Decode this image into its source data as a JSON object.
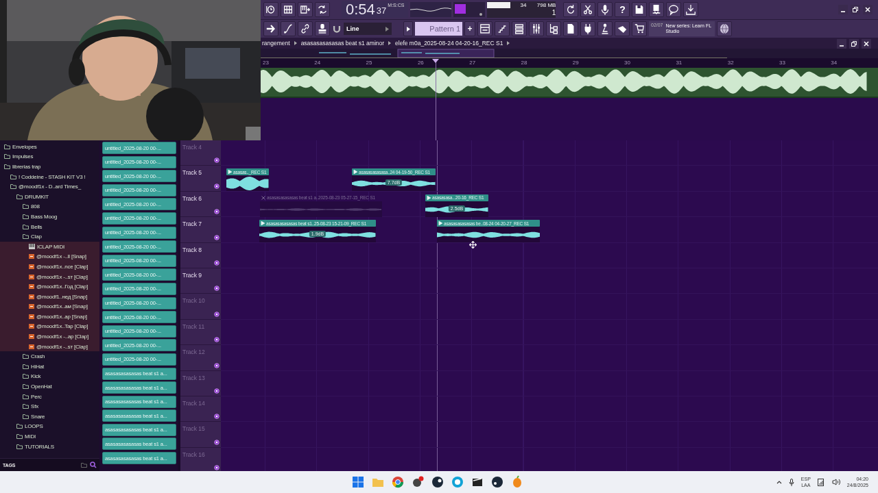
{
  "toolbar": {
    "time": "0:54",
    "time_small": "37",
    "time_format": "M:S:CS",
    "cpu": "34",
    "memory": "798 MB",
    "polyphony": "1",
    "help": "?",
    "snap": "Line",
    "pattern": "Pattern 1",
    "pattern_add": "+",
    "news_count": "02/07",
    "news_text": "New series: Learn FL Studio"
  },
  "breadcrumb": [
    "rangement",
    "asasasasasasas beat s1 aminor",
    "elefe m0a_2025-08-24 04-20-16_REC S1"
  ],
  "ruler": [
    "23",
    "24",
    "25",
    "26",
    "27",
    "28",
    "29",
    "30",
    "31",
    "32",
    "33",
    "34"
  ],
  "browser": {
    "items": [
      {
        "label": "Envelopes",
        "kind": "folder"
      },
      {
        "label": "Impulses",
        "kind": "folder"
      },
      {
        "label": "librerias trap",
        "kind": "folder",
        "children": [
          {
            "label": "! Coddeine - STASH KIT V3 !",
            "kind": "folder"
          },
          {
            "label": "@moodf1x - D..ard Times_",
            "kind": "folder",
            "children": [
              {
                "label": "DRUMKIT",
                "kind": "folder",
                "children": [
                  {
                    "label": "808",
                    "kind": "folder"
                  },
                  {
                    "label": "Bass Moog",
                    "kind": "folder"
                  },
                  {
                    "label": "Bells",
                    "kind": "folder"
                  },
                  {
                    "label": "Clap",
                    "kind": "folder",
                    "children": [
                      {
                        "label": "ICLAP MIDI",
                        "kind": "midi"
                      },
                      {
                        "label": "@moodf1x -..ll [Snap]",
                        "kind": "audio"
                      },
                      {
                        "label": "@moodf1x..nce [Clap]",
                        "kind": "audio"
                      },
                      {
                        "label": "@moodf1x -..sт [Clap]",
                        "kind": "audio"
                      },
                      {
                        "label": "@moodf1x..Год [Clap]",
                        "kind": "audio"
                      },
                      {
                        "label": "@moodf1..нед [Snap]",
                        "kind": "audio"
                      },
                      {
                        "label": "@moodf1x..ам [Snap]",
                        "kind": "audio"
                      },
                      {
                        "label": "@moodf1x..ap [Snap]",
                        "kind": "audio"
                      },
                      {
                        "label": "@moodf1x..Tap [Clap]",
                        "kind": "audio"
                      },
                      {
                        "label": "@moodf1x -..ap [Clap]",
                        "kind": "audio"
                      },
                      {
                        "label": "@moodf1x -..sт [Clap]",
                        "kind": "audio"
                      }
                    ]
                  },
                  {
                    "label": "Crash",
                    "kind": "folder"
                  },
                  {
                    "label": "HiHat",
                    "kind": "folder"
                  },
                  {
                    "label": "Kick",
                    "kind": "folder"
                  },
                  {
                    "label": "OpenHat",
                    "kind": "folder"
                  },
                  {
                    "label": "Perc",
                    "kind": "folder"
                  },
                  {
                    "label": "Sfx",
                    "kind": "folder"
                  },
                  {
                    "label": "Snare",
                    "kind": "folder"
                  }
                ]
              },
              {
                "label": "LOOPS",
                "kind": "folder"
              },
              {
                "label": "MIDI",
                "kind": "folder"
              },
              {
                "label": "TUTORIALS",
                "kind": "folder"
              }
            ]
          }
        ]
      }
    ],
    "footer": "TAGS"
  },
  "clip_list": [
    "untitled_2025-08-20 00-...",
    "untitled_2025-08-20 00-...",
    "untitled_2025-08-20 00-...",
    "untitled_2025-08-20 00-...",
    "untitled_2025-08-20 00-...",
    "untitled_2025-08-20 00-...",
    "untitled_2025-08-20 00-...",
    "untitled_2025-08-20 00-...",
    "untitled_2025-08-20 00-...",
    "untitled_2025-08-20 00-...",
    "untitled_2025-08-20 00-...",
    "untitled_2025-08-20 00-...",
    "untitled_2025-08-20 00-...",
    "untitled_2025-08-20 00-...",
    "untitled_2025-08-20 00-...",
    "untitled_2025-08-20 00-...",
    "asasasasasasas beat s1 a...",
    "asasasasasasas beat s1 a...",
    "asasasasasasas beat s1 a...",
    "asasasasasasas beat s1 a...",
    "asasasasasasas beat s1 a...",
    "asasasasasasas beat s1 a...",
    "asasasasasasas beat s1 a..."
  ],
  "tracks": [
    {
      "name": "Track 4",
      "dimmed": true
    },
    {
      "name": "Track 5",
      "dimmed": false,
      "clips": [
        {
          "label": "asasas.._REC S1",
          "muted": false
        },
        {
          "label": "asasasasasasa..24 04-19-50_REC S1",
          "gain": "7.7dB",
          "muted": false
        }
      ]
    },
    {
      "name": "Track 6",
      "dimmed": false,
      "clips": [
        {
          "label": "asasasasasasas beat s1 a..2025-08-23 05-27-15_REC S1",
          "muted": true
        },
        {
          "label": "asasasasa...20-16_REC S1",
          "gain": "2.5dB",
          "muted": false
        }
      ]
    },
    {
      "name": "Track 7",
      "dimmed": false,
      "clips": [
        {
          "label": "asasasasasasas beat s1..25-08-23 15-21-09_REC S1",
          "gain": "1.9dB",
          "muted": false
        },
        {
          "label": "asasasasasasas be..08-24 04-20-27_REC S1",
          "muted": false
        }
      ]
    },
    {
      "name": "Track 8",
      "dimmed": false
    },
    {
      "name": "Track 9",
      "dimmed": false
    },
    {
      "name": "Track 10",
      "dimmed": true
    },
    {
      "name": "Track 11",
      "dimmed": true
    },
    {
      "name": "Track 12",
      "dimmed": true
    },
    {
      "name": "Track 13",
      "dimmed": true
    },
    {
      "name": "Track 14",
      "dimmed": true
    },
    {
      "name": "Track 15",
      "dimmed": true
    },
    {
      "name": "Track 16",
      "dimmed": true
    }
  ],
  "taskbar": {
    "language": "ESP",
    "region": "LAA",
    "time": "04:20",
    "date": "24/8/2025"
  }
}
